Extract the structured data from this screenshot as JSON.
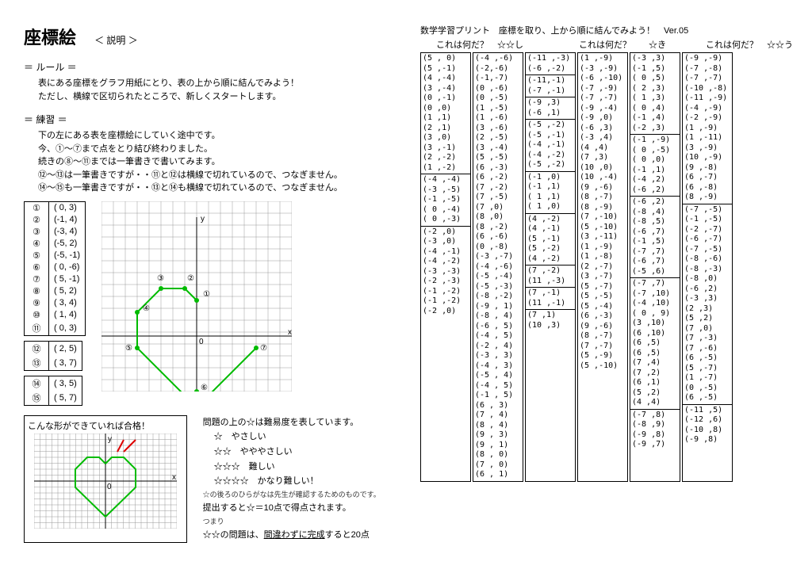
{
  "title": "座標絵",
  "subtitle": "＜ 説明 ＞",
  "rule_label": "＝ ルール ＝",
  "rule_text1": "表にある座標をグラフ用紙にとり、表の上から順に結んでみよう！",
  "rule_text2": "ただし、横線で区切られたところで、新しくスタートします。",
  "practice_label": "＝ 練習 ＝",
  "practice_text1": "下の左にある表を座標絵にしていく途中です。",
  "practice_text2": "今、①～⑦まで点をとり結び終わりました。",
  "practice_text3": "続きの⑧～⑪までは一筆書きで書いてみます。",
  "practice_text4": "⑫～⑬は一筆書きですが・・⑪と⑫は横線で切れているので、つなぎません。",
  "practice_text5": "⑭～⑮も一筆書きですが・・⑬と⑭も横線で切れているので、つなぎません。",
  "table1": [
    {
      "n": "①",
      "v": "( 0,   3)"
    },
    {
      "n": "②",
      "v": "(-1,   4)"
    },
    {
      "n": "③",
      "v": "(-3,   4)"
    },
    {
      "n": "④",
      "v": "(-5,   2)"
    },
    {
      "n": "⑤",
      "v": "(-5, -1)"
    },
    {
      "n": "⑥",
      "v": "( 0, -6)"
    },
    {
      "n": "⑦",
      "v": "( 5, -1)"
    },
    {
      "n": "⑧",
      "v": "( 5,   2)"
    },
    {
      "n": "⑨",
      "v": "( 3,   4)"
    },
    {
      "n": "⑩",
      "v": "( 1,   4)"
    },
    {
      "n": "⑪",
      "v": "( 0,   3)"
    }
  ],
  "table2": [
    {
      "n": "⑫",
      "v": "( 2,   5)"
    },
    {
      "n": "⑬",
      "v": "( 3,   7)"
    }
  ],
  "table3": [
    {
      "n": "⑭",
      "v": "( 3,   5)"
    },
    {
      "n": "⑮",
      "v": "( 5,   7)"
    }
  ],
  "sample_title": "こんな形ができていれば合格！",
  "diff_title": "問題の上の☆は難易度を表しています。",
  "diff1": "☆　やさしい",
  "diff2": "☆☆　やややさしい",
  "diff3": "☆☆☆　難しい",
  "diff4": "☆☆☆☆　かなり難しい！",
  "diff_note": "☆の後ろのひらがなは先生が確認するためのものです。",
  "submit_text": "提出すると☆＝10点で得点されます。",
  "tsumari": "つまり",
  "submit_text2a": "☆☆の問題は、",
  "submit_text2b": "間違わずに完成",
  "submit_text2c": "すると20点",
  "header_right": "数学学習プリント　座標を取り、上から順に結んでみよう！　Ver.05",
  "quiz_label1": "これは何だ？　☆☆し",
  "quiz_label2": "これは何だ？　　☆き",
  "quiz_label3": "これは何だ？　☆☆う",
  "col1a": [
    "(5 , 0)",
    "(5 ,-1)",
    "(4 ,-4)",
    "(3 ,-4)",
    "(0 ,-1)",
    "(0 ,0)",
    "(1 ,1)",
    "(2 ,1)",
    "(3 ,0)",
    "(3 ,-1)",
    "(2 ,-2)",
    "(1 ,-2)"
  ],
  "col1b": [
    "(-4 ,-6)",
    "(-2,-6)",
    "(-1,-7)",
    "(0 ,-6)",
    "(0 ,-5)",
    "(1 ,-5)",
    "(1 ,-6)",
    "(3 ,-6)",
    "(2 ,-5)",
    "(3 ,-4)",
    "(5 ,-5)",
    "(6 ,-3)",
    "(6 ,-2)",
    "(7 ,-2)",
    "(7 ,-5)",
    "(7 ,0)",
    "(8 ,0)",
    "(8 ,-2)",
    "(6 ,-6)",
    "(0 ,-8)",
    "(-3 ,-7)",
    "(-4 ,-6)",
    "(-5 ,-4)",
    "(-5 ,-3)",
    "(-8 ,-2)",
    "(-9 , 1)",
    "(-8 , 4)",
    "(-6 , 5)",
    "(-4 , 5)",
    "(-2 , 4)",
    "(-3 , 3)",
    "(-4 , 3)",
    "(-5 , 4)",
    "(-4 , 5)",
    "(-1 , 5)",
    "(6 , 3)",
    "(7 , 4)",
    "(8 , 4)",
    "(9 , 3)",
    "(9 , 1)",
    "(8 , 0)",
    "(7 , 0)",
    "(6 , 1)"
  ],
  "col1c": [
    "(-4 ,-4)",
    "(-3 ,-5)",
    "(-1 ,-5)",
    "( 0 ,-4)",
    "( 0 ,-3)"
  ],
  "col1d": [
    "(-2 ,0)",
    "(-3 ,0)",
    "(-4 ,-1)",
    "(-4 ,-2)",
    "(-3 ,-3)",
    "(-2 ,-3)",
    "(-1 ,-2)",
    "(-1 ,-2)",
    "(-2 ,0)"
  ],
  "col2a": [
    "(-11 ,-3)",
    "(-6 ,-2)"
  ],
  "col2b": [
    "(-11,-1)",
    "(-7 ,-1)"
  ],
  "col2c": [
    "(-9 ,3)",
    "(-6 ,1)"
  ],
  "col2d": [
    "(-5 ,-2)",
    "(-5 ,-1)",
    "(-4 ,-1)",
    "(-4 ,-2)",
    "(-5 ,-2)"
  ],
  "col2e": [
    "(-1 ,0)",
    "(-1 ,1)",
    "( 1 ,1)",
    "( 1 ,0)"
  ],
  "col2f": [
    "(4 ,-2)",
    "(4 ,-1)",
    "(5 ,-1)",
    "(5 ,-2)",
    "(4 ,-2)"
  ],
  "col2g": [
    "(7  ,-2)",
    "(11 ,-3)"
  ],
  "col2h": [
    "(7  ,-1)",
    "(11 ,-1)"
  ],
  "col2i": [
    "(7  ,1)",
    "(10 ,3)"
  ],
  "col3a": [
    "(1 ,-9)",
    "(-3 ,-9)",
    "(-6 ,-10)",
    "(-7 ,-9)",
    "(-7 ,-7)",
    "(-9 ,-4)",
    "(-9 ,0)",
    "(-6 ,3)",
    "(-3 ,4)",
    "(4 ,4)",
    "(7 ,3)",
    "(10 ,0)",
    "(10 ,-4)",
    "(9 ,-6)",
    "(8 ,-7)",
    "(8 ,-9)",
    "(7 ,-10)",
    "(5 ,-10)",
    "(3 ,-11)",
    "(1 ,-9)",
    "(1 ,-8)",
    "(2 ,-7)",
    "(3 ,-7)",
    "(5 ,-7)",
    "(5 ,-5)",
    "(5 ,-4)",
    "(6 ,-3)",
    "(9 ,-6)",
    "(8 ,-7)",
    "(7 ,-7)",
    "(5 ,-9)",
    "(5 ,-10)"
  ],
  "col4a": [
    "(-3 ,3)",
    "(-1 ,5)",
    "( 0 ,5)",
    "( 2 ,3)",
    "( 1 ,3)",
    "( 0 ,4)",
    "(-1 ,4)",
    "(-2 ,3)"
  ],
  "col4b": [
    "(-1 ,-9)",
    "( 0 ,-5)",
    "( 0 ,0)",
    "(-1 ,1)",
    "(-4 ,2)",
    "(-6 ,2)"
  ],
  "col4c": [
    "(-6 ,2)",
    "(-8 ,4)",
    "(-8 ,5)",
    "(-6 ,7)",
    "(-1 ,5)",
    "(-7 ,7)",
    "(-6 ,7)",
    "(-5 ,6)"
  ],
  "col4d": [
    "(-7 ,7)",
    "(-7 ,10)",
    "(-4 ,10)",
    "( 0 , 9)",
    "(3 ,10)",
    "(6 ,10)",
    "(6 ,5)",
    "(6 ,5)",
    "(7 ,4)",
    "(7 ,2)",
    "(6 ,1)",
    "(5 ,2)",
    "(4 ,4)"
  ],
  "col4e": [
    "(-7 ,8)",
    "(-8 ,9)",
    "(-9 ,8)",
    "(-9 ,7)"
  ],
  "col5a": [
    "(-9 ,-9)",
    "(-7 ,-8)",
    "(-7 ,-7)",
    "(-10 ,-8)",
    "(-11 ,-9)",
    "(-4 ,-9)",
    "(-2 ,-9)",
    "(1 ,-9)",
    "(1 ,-11)",
    "(3 ,-9)",
    "(10 ,-9)",
    "(9 ,-8)",
    "(6 ,-7)",
    "(6 ,-8)",
    "(8 ,-9)"
  ],
  "col5b": [
    "(-7 ,-5)",
    "(-1 ,-5)",
    "(-2 ,-7)",
    "(-6 ,-7)",
    "(-7 ,-5)",
    "(-8 ,-6)",
    "(-8 ,-3)",
    "(-8 ,0)",
    "(-6 ,2)",
    "(-3 ,3)",
    "(2 ,3)",
    "(5 ,2)",
    "(7 ,0)",
    "(7 ,-3)",
    "(7 ,-6)",
    "(6 ,-5)",
    "(5 ,-7)",
    "(1 ,-7)",
    "(0 ,-5)",
    "(6 ,-5)"
  ],
  "col5c": [
    "(-11 ,5)",
    "(-12 ,6)",
    "(-10 ,8)",
    "(-9 ,8)"
  ]
}
